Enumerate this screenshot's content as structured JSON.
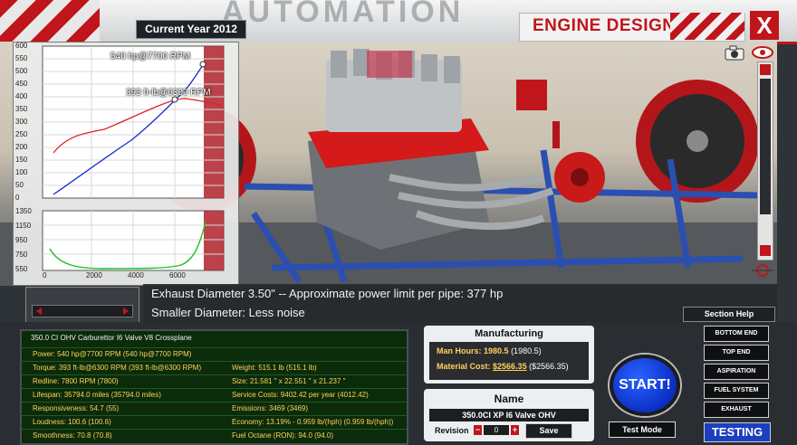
{
  "header": {
    "brand": "AUTOMATION",
    "current_year": "Current Year 2012",
    "title": "ENGINE DESIGN",
    "close_label": "X"
  },
  "graphs": {
    "power_label": "540 hp@7700 RPM",
    "torque_label": "393 ft-lb@6300 RPM",
    "top_ticks": [
      "600",
      "550",
      "500",
      "450",
      "400",
      "350",
      "300",
      "250",
      "200",
      "150",
      "100",
      "50",
      "0"
    ],
    "bottom_ticks": [
      "1350",
      "1150",
      "950",
      "750",
      "550"
    ],
    "x_ticks": [
      "0",
      "2000",
      "4000",
      "6000"
    ]
  },
  "info": {
    "line1": "Exhaust Diameter 3.50\" -- Approximate power limit per pipe: 377 hp",
    "line2": "Smaller Diameter: Less noise",
    "section_help": "Section Help"
  },
  "specs": {
    "header": "350.0 CI OHV Carburettor I6 Valve V8 Crossplane",
    "left": [
      "Power: 540 hp@7700 RPM (540 hp@7700 RPM)",
      "Torque: 393 ft-lb@6300 RPM (393 ft-lb@6300 RPM)",
      "Redline: 7800 RPM (7800)",
      "Lifespan: 35794.0 miles (35794.0 miles)",
      "Responsiveness: 54.7 (55)",
      "Loudness: 100.6 (100.6)",
      "Smoothness: 70.8 (70.8)"
    ],
    "right": [
      "",
      "Weight: 515.1 lb (515.1 lb)",
      "Size: 21.581 \" x 22.551 \" x 21.237 \"",
      "Service Costs: 9402.42 per year (4012.42)",
      "Emissions: 3469 (3469)",
      "Economy: 13.19% - 0.959 lb/(hph) (0.959 lb/(hph))",
      "Fuel Octane (RON): 94.0 (94.0)"
    ]
  },
  "manufacturing": {
    "title": "Manufacturing",
    "man_hours_label": "Man Hours:",
    "man_hours_value": "1980.5",
    "man_hours_paren": "(1980.5)",
    "material_label": "Material Cost:",
    "material_value": "$2566.35",
    "material_paren": "($2566.35)"
  },
  "name_panel": {
    "title": "Name",
    "engine_name": "350.0CI XP I6 Valve OHV",
    "revision_label": "Revision",
    "revision_value": "0",
    "save_label": "Save"
  },
  "actions": {
    "start_label": "START!",
    "test_mode_label": "Test Mode",
    "testing_label": "TESTING"
  },
  "nav": [
    "BOTTOM END",
    "TOP END",
    "ASPIRATION",
    "FUEL SYSTEM",
    "EXHAUST"
  ],
  "colors": {
    "accent_red": "#c0161b",
    "power_curve": "#1a2ccf",
    "torque_curve": "#e02020",
    "spec_text": "#ffd35a"
  }
}
